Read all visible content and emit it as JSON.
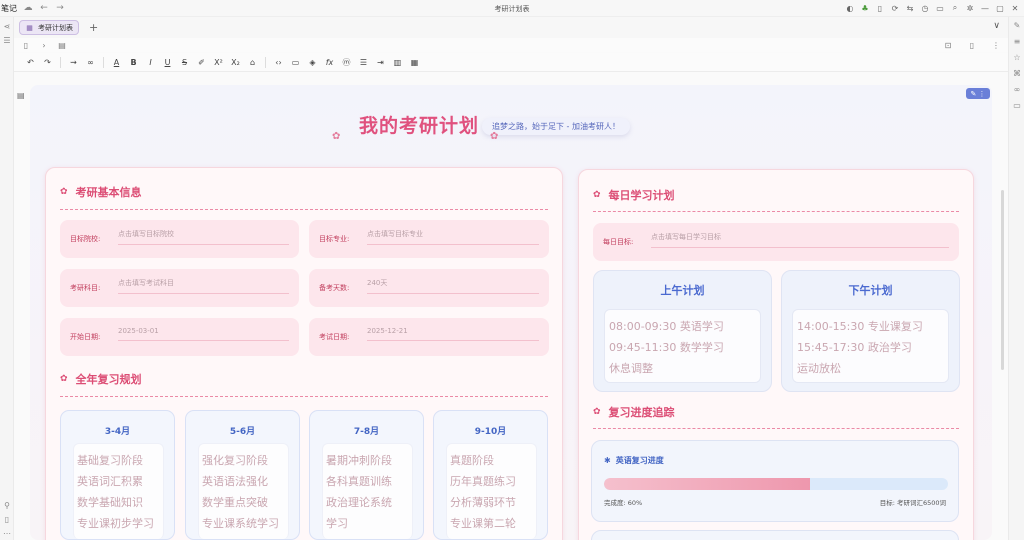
{
  "app": {
    "name": "笔记",
    "window_title": "考研计划表"
  },
  "tabs": [
    {
      "label": "考研计划表",
      "active": true
    }
  ],
  "page": {
    "title": "我的考研计划",
    "subtitle": "追梦之路，始于足下 - 加油考研人！"
  },
  "basic_info": {
    "title": "考研基本信息",
    "fields": [
      {
        "label": "目标院校:",
        "value": "点击填写目标院校"
      },
      {
        "label": "目标专业:",
        "value": "点击填写目标专业"
      },
      {
        "label": "考研科目:",
        "value": "点击填写考试科目"
      },
      {
        "label": "备考天数:",
        "value": "240天"
      },
      {
        "label": "开始日期:",
        "value": "2025-03-01"
      },
      {
        "label": "考试日期:",
        "value": "2025-12-21"
      }
    ]
  },
  "yearly_plan": {
    "title": "全年复习规划",
    "phases": [
      {
        "period": "3-4月",
        "items": [
          "基础复习阶段",
          "英语词汇积累",
          "数学基础知识",
          "专业课初步学习"
        ]
      },
      {
        "period": "5-6月",
        "items": [
          "强化复习阶段",
          "英语语法强化",
          "数学重点突破",
          "专业课系统学习"
        ]
      },
      {
        "period": "7-8月",
        "items": [
          "暑期冲刺阶段",
          "各科真题训练",
          "政治理论系统",
          "学习"
        ]
      },
      {
        "period": "9-10月",
        "items": [
          "真题阶段",
          "历年真题练习",
          "分析薄弱环节",
          "专业课第二轮"
        ]
      }
    ]
  },
  "daily_plan": {
    "title": "每日学习计划",
    "goal_label": "每日目标:",
    "goal_value": "点击填写每日学习目标",
    "morning": {
      "title": "上午计划",
      "items": [
        "08:00-09:30 英语学习",
        "09:45-11:30 数学学习",
        "休息调整"
      ]
    },
    "afternoon": {
      "title": "下午计划",
      "items": [
        "14:00-15:30 专业课复习",
        "15:45-17:30 政治学习",
        "运动放松"
      ]
    }
  },
  "progress": {
    "title": "复习进度追踪",
    "english": {
      "title": "英语复习进度",
      "percent": 60,
      "done_label": "完成度: 60%",
      "target_label": "目标: 考研词汇6500词"
    }
  },
  "colors": {
    "accent_pink": "#dc4d75",
    "accent_blue": "#4466c4",
    "progress_fill": "#ee97ad",
    "progress_track": "#dbe9fa"
  }
}
